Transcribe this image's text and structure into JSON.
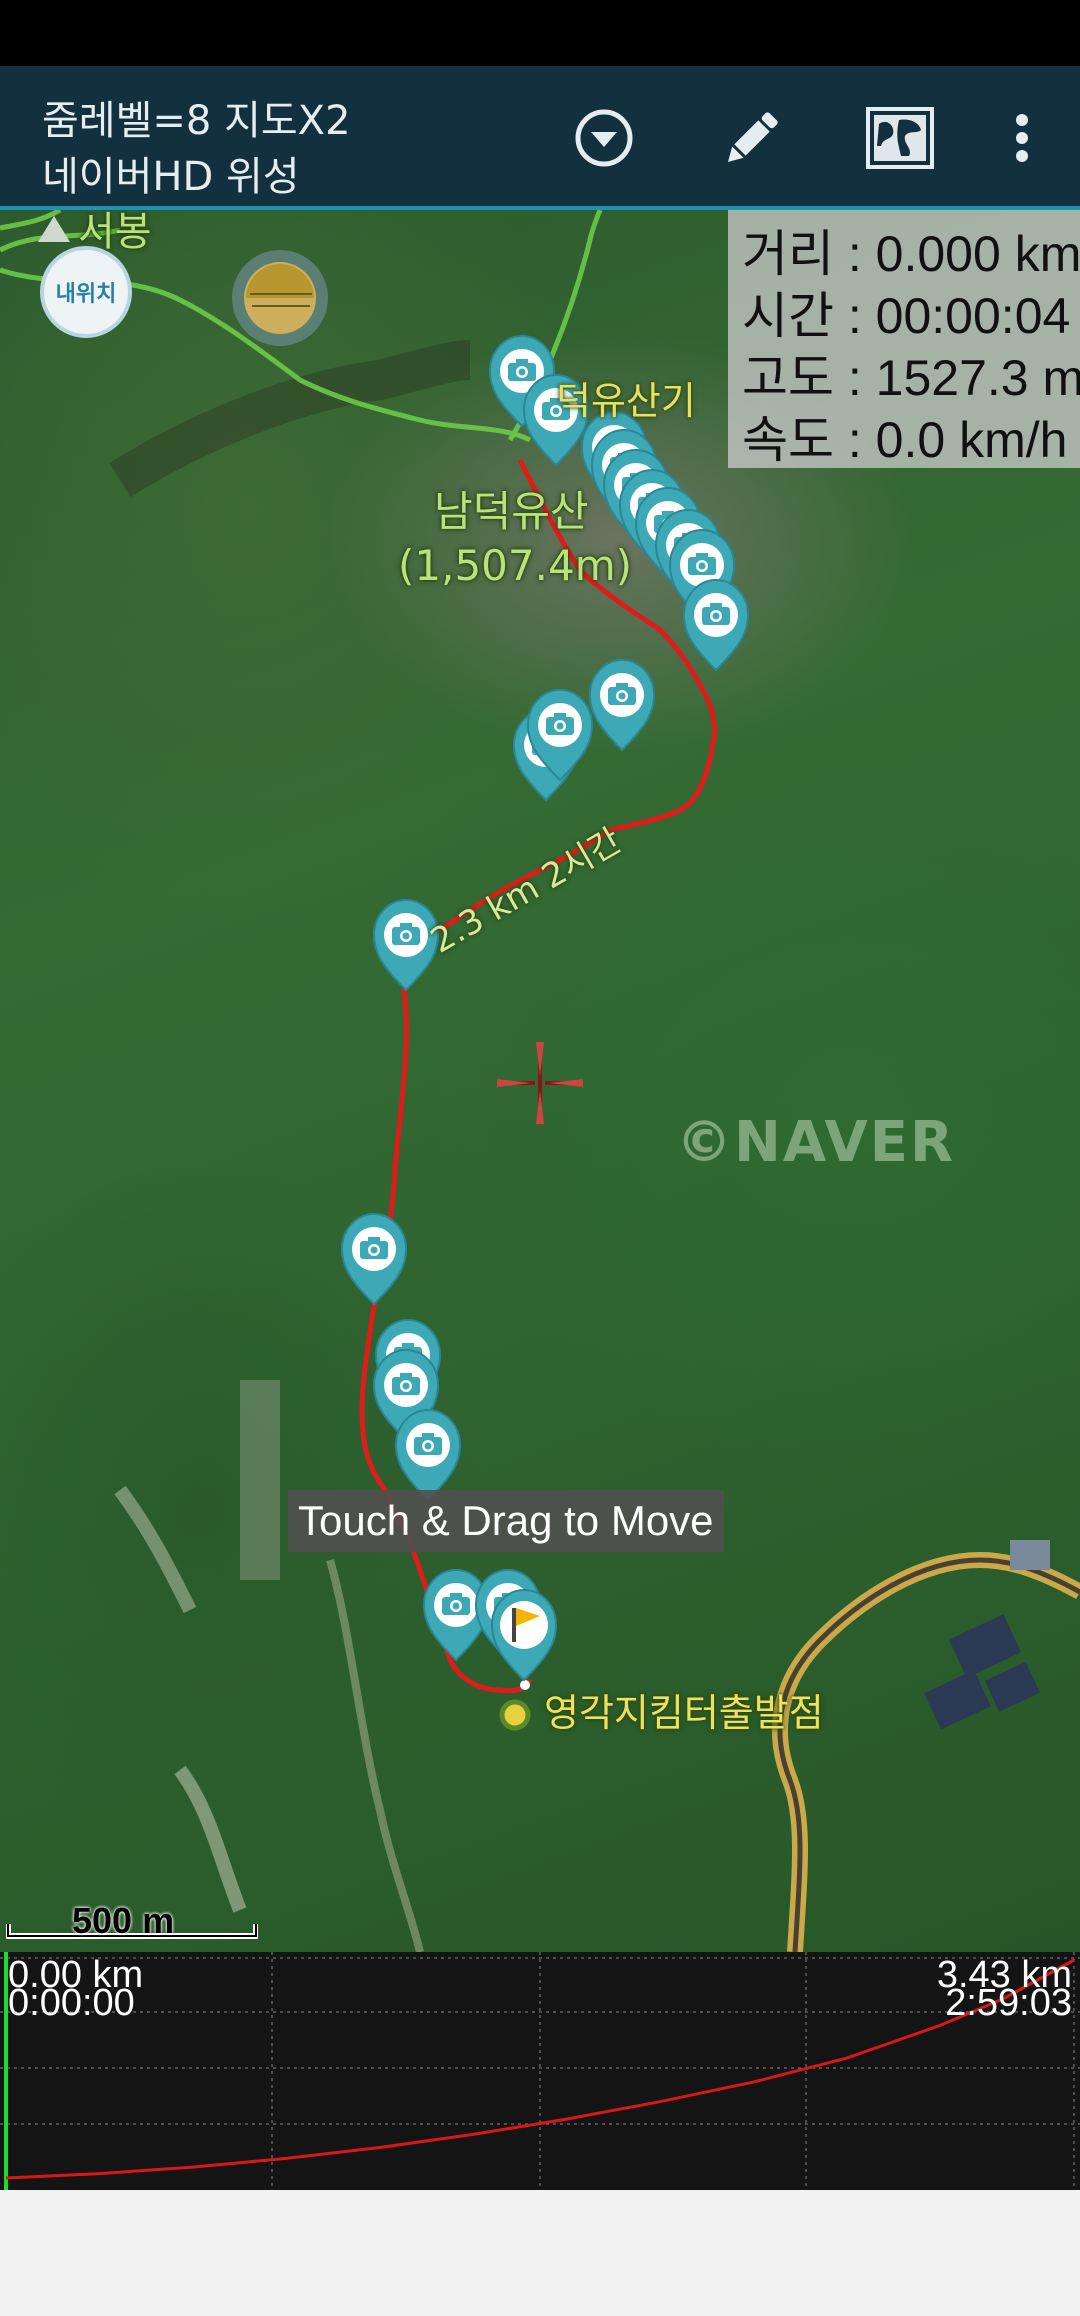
{
  "toolbar": {
    "zoom_text": "줌레벨=8 지도X2",
    "map_type": "네이버HD 위성",
    "icons": [
      "chevron-down-circle-icon",
      "pencil-icon",
      "map-icon",
      "more-vert-icon"
    ]
  },
  "map": {
    "my_location_label": "내위치",
    "info": {
      "distance": "거리 : 0.000 km",
      "time": "시간 : 00:00:04",
      "altitude": "고도 : 1527.3 m",
      "speed": "속도 : 0.0 km/h"
    },
    "labels": {
      "seobong": "서봉",
      "peak_area": "덕유산기",
      "peak_name": "남덕유산",
      "peak_elev": "(1,507.4m)",
      "trail": "2.3 km 2시간",
      "trailhead": "영각지킴터출발점"
    },
    "watermark": "©NAVER",
    "toast": "Touch & Drag to Move",
    "scale": "500 m",
    "colors": {
      "track": "#e01b1b",
      "marker": "#3ea9b6",
      "road": "#c9a94a"
    }
  },
  "chart_data": {
    "type": "line",
    "x_start_distance": "0.00 km",
    "x_start_time": "0:00:00",
    "x_end_distance": "3.43 km",
    "x_end_time": "2:59:03",
    "x": [
      0,
      0.3,
      0.6,
      0.9,
      1.2,
      1.5,
      1.8,
      2.1,
      2.4,
      2.7,
      3.0,
      3.2,
      3.43
    ],
    "y": [
      0,
      2,
      5,
      9,
      14,
      20,
      27,
      35,
      44,
      55,
      70,
      82,
      100
    ],
    "grid": true
  }
}
